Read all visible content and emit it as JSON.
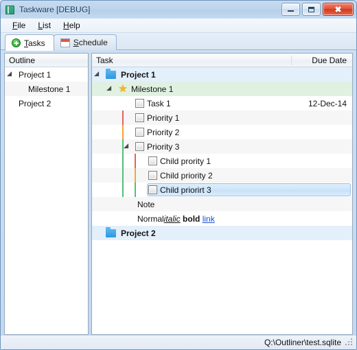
{
  "window": {
    "title": "Taskware [DEBUG]",
    "icon": "app-book-icon",
    "controls": {
      "minimize": "Minimize",
      "maximize": "Maximize",
      "close": "✖"
    }
  },
  "menu": {
    "items": [
      {
        "label": "File",
        "mnemonic": "F"
      },
      {
        "label": "List",
        "mnemonic": "L"
      },
      {
        "label": "Help",
        "mnemonic": "H"
      }
    ]
  },
  "tabs": [
    {
      "label": "Tasks",
      "mnemonic": "T",
      "icon": "plus-circle-icon",
      "active": true
    },
    {
      "label": "Schedule",
      "mnemonic": "S",
      "icon": "calendar-icon",
      "active": false
    }
  ],
  "outline": {
    "header": "Outline",
    "rows": [
      {
        "label": "Project 1",
        "indent": 0,
        "expander": true
      },
      {
        "label": "Milestone 1",
        "indent": 1,
        "expander": false
      },
      {
        "label": "Project 2",
        "indent": 0,
        "expander": false
      }
    ]
  },
  "tasks": {
    "headers": {
      "task": "Task",
      "due": "Due Date"
    },
    "rows": [
      {
        "label": "Project 1",
        "due": "",
        "type": "project",
        "indent": 0,
        "expander": true
      },
      {
        "label": "Milestone 1",
        "due": "",
        "type": "milestone",
        "indent": 1,
        "expander": true
      },
      {
        "label": "Task 1",
        "due": "12-Dec-14",
        "type": "task",
        "indent": 2,
        "expander": false
      },
      {
        "label": "Priority 1",
        "due": "",
        "type": "task",
        "indent": 2,
        "expander": false,
        "priority_color": "#e8605a"
      },
      {
        "label": "Priority 2",
        "due": "",
        "type": "task",
        "indent": 2,
        "expander": false,
        "priority_color": "#f0a833"
      },
      {
        "label": "Priority 3",
        "due": "",
        "type": "task",
        "indent": 2,
        "expander": true,
        "priority_color": "#4fc07a"
      },
      {
        "label": "Child prority 1",
        "due": "",
        "type": "task",
        "indent": 3,
        "expander": false,
        "priority_color": "#e8605a"
      },
      {
        "label": "Child priority 2",
        "due": "",
        "type": "task",
        "indent": 3,
        "expander": false,
        "priority_color": "#f0a833"
      },
      {
        "label": "Child priorirt 3",
        "due": "",
        "type": "task",
        "indent": 3,
        "expander": false,
        "priority_color": "#4fc07a",
        "selected": true
      }
    ],
    "note_rows": [
      {
        "text": "Note"
      },
      {
        "rich": [
          {
            "text": "Normal ",
            "style": "normal"
          },
          {
            "text": "italic",
            "style": "italic"
          },
          {
            "text": " ",
            "style": "normal"
          },
          {
            "text": "bold",
            "style": "bold"
          },
          {
            "text": " ",
            "style": "normal"
          },
          {
            "text": "link",
            "style": "link"
          }
        ]
      }
    ],
    "footer_row": {
      "label": "Project 2",
      "due": "",
      "type": "project",
      "indent": 0,
      "expander": false
    }
  },
  "statusbar": {
    "path": "Q:\\Outliner\\test.sqlite"
  },
  "colors": {
    "priority_high": "#e8605a",
    "priority_medium": "#f0a833",
    "priority_low": "#4fc07a",
    "project_row": "#e3f0fb",
    "milestone_row": "#e1f1e1",
    "selection": "#cfe6fa",
    "accent": "#2f96df"
  }
}
